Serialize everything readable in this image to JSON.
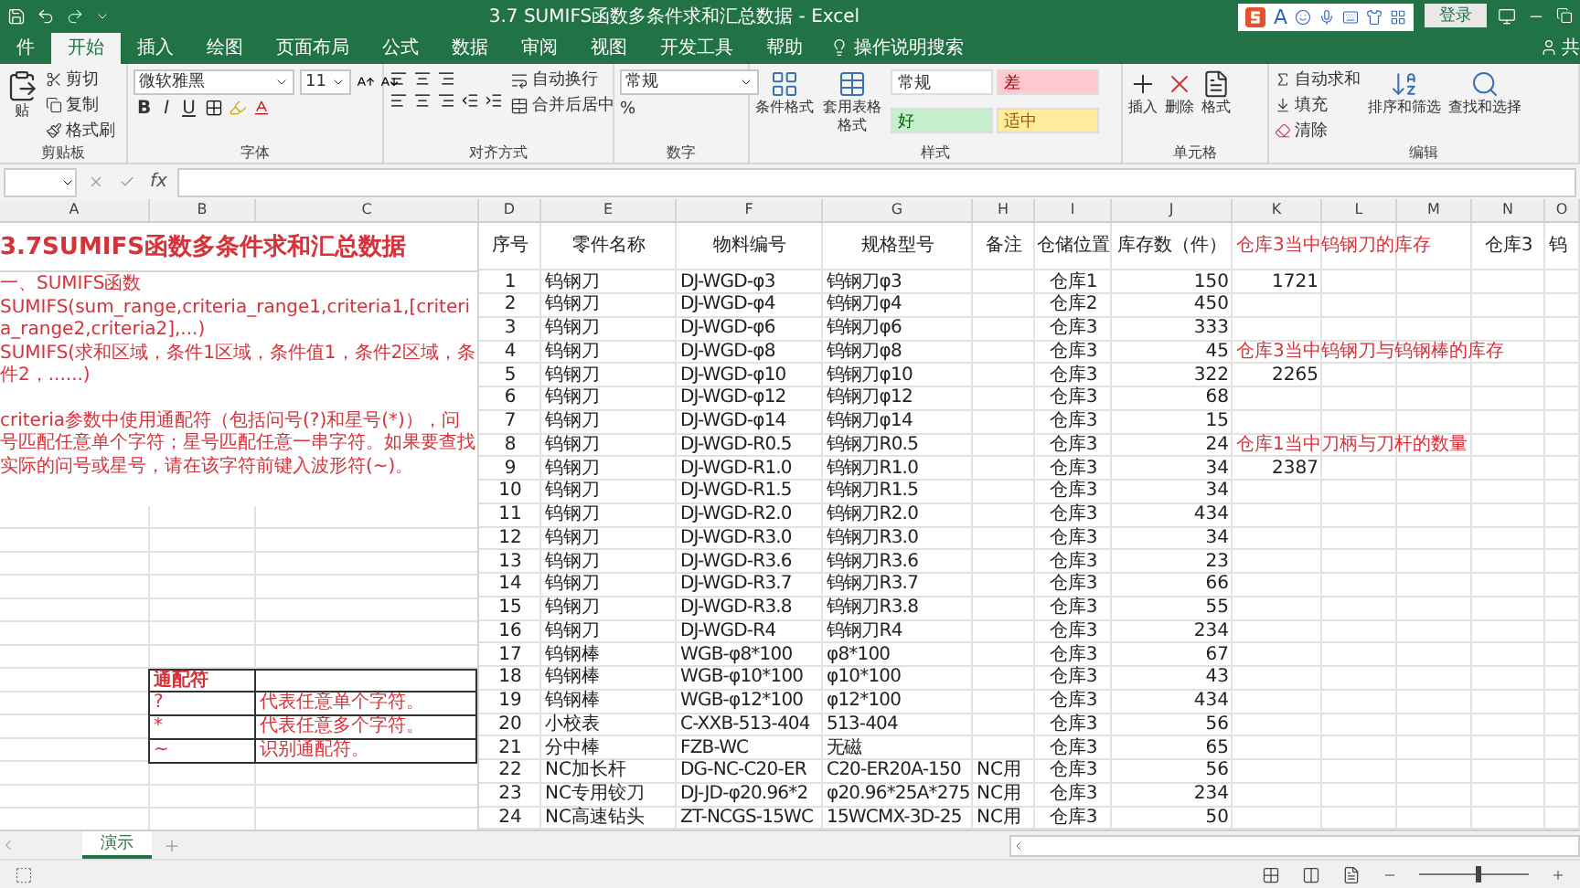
{
  "window": {
    "title": "3.7 SUMIFS函数多条件求和汇总数据  -  Excel",
    "login": "登录",
    "ime": {
      "letter": "A"
    },
    "share": "共"
  },
  "tabs": [
    {
      "label": "件",
      "selected": false
    },
    {
      "label": "开始",
      "selected": true
    },
    {
      "label": "插入",
      "selected": false
    },
    {
      "label": "绘图",
      "selected": false
    },
    {
      "label": "页面布局",
      "selected": false
    },
    {
      "label": "公式",
      "selected": false
    },
    {
      "label": "数据",
      "selected": false
    },
    {
      "label": "审阅",
      "selected": false
    },
    {
      "label": "视图",
      "selected": false
    },
    {
      "label": "开发工具",
      "selected": false
    },
    {
      "label": "帮助",
      "selected": false
    }
  ],
  "tell_me": {
    "placeholder": "操作说明搜索"
  },
  "ribbon": [
    {
      "kind": "clipboard",
      "label": "剪贴板",
      "paste": "贴",
      "items": [
        "剪切",
        "复制",
        "格式刷"
      ]
    },
    {
      "kind": "font",
      "label": "字体",
      "font": "微软雅黑",
      "size": "11",
      "styles": [
        "B",
        "I",
        "U"
      ]
    },
    {
      "kind": "align",
      "label": "对齐方式",
      "items": [
        "自动换行",
        "合并后居中"
      ]
    },
    {
      "kind": "number",
      "label": "数字",
      "format": "常规",
      "percent": "%"
    },
    {
      "kind": "styles",
      "label": "样式",
      "buttons": [
        "条件格式",
        "套用表格格式"
      ],
      "cell_styles": [
        {
          "text": "常规",
          "color": "#ffffff"
        },
        {
          "text": "差",
          "color": "#ffc7ce"
        },
        {
          "text": "好",
          "color": "#c6efce"
        },
        {
          "text": "适中",
          "color": "#ffeb9c"
        }
      ]
    },
    {
      "kind": "cells",
      "label": "单元格",
      "buttons": [
        "插入",
        "删除",
        "格式"
      ]
    },
    {
      "kind": "editing",
      "label": "编辑",
      "items": [
        "自动求和",
        "填充",
        "清除"
      ],
      "buttons": [
        "排序和筛选",
        "查找和选择"
      ]
    }
  ],
  "formula_bar": {
    "fx": "fx"
  },
  "columns": [
    "A",
    "B",
    "C",
    "D",
    "E",
    "F",
    "G",
    "H",
    "I",
    "J",
    "K",
    "L",
    "M",
    "N",
    "O"
  ],
  "sheet_title": "3.7SUMIFS函数多条件求和汇总数据",
  "notes": [
    {
      "kind": "syntax",
      "text": "一、SUMIFS函数"
    },
    {
      "kind": "syntax",
      "text": "SUMIFS(sum_range,criteria_range1,criteria1,[criteria_range2,criteria2],...)"
    },
    {
      "kind": "syntax",
      "text": "SUMIFS(求和区域，条件1区域，条件值1，条件2区域，条件2，......)"
    },
    {
      "kind": "tip",
      "text": "criteria参数中使用通配符（包括问号(?)和星号(*)），问号匹配任意单个字符；星号匹配任意一串字符。如果要查找实际的问号或星号，请在该字符前键入波形符(~)。"
    }
  ],
  "wildcards": {
    "heading": "通配符",
    "rows": [
      {
        "symbol": "?",
        "meaning": "代表任意单个字符。"
      },
      {
        "symbol": "*",
        "meaning": "代表任意多个字符。"
      },
      {
        "symbol": "~",
        "meaning": "识别通配符。"
      }
    ]
  },
  "table": {
    "headers": [
      "序号",
      "零件名称",
      "物料编号",
      "规格型号",
      "备注",
      "仓储位置",
      "库存数（件）"
    ],
    "k_label": "仓库3当中钨钢刀的库存",
    "n_header": "仓库3",
    "o_header": "钨",
    "rows": [
      {
        "no": "1",
        "part": "钨钢刀",
        "code": "DJ-WGD-φ3",
        "spec": "钨钢刀φ3",
        "loc": "仓库1",
        "qty": "150",
        "k": {
          "kind": "value",
          "text": "1721"
        }
      },
      {
        "no": "2",
        "part": "钨钢刀",
        "code": "DJ-WGD-φ4",
        "spec": "钨钢刀φ4",
        "loc": "仓库2",
        "qty": "450"
      },
      {
        "no": "3",
        "part": "钨钢刀",
        "code": "DJ-WGD-φ6",
        "spec": "钨钢刀φ6",
        "loc": "仓库3",
        "qty": "333"
      },
      {
        "no": "4",
        "part": "钨钢刀",
        "code": "DJ-WGD-φ8",
        "spec": "钨钢刀φ8",
        "loc": "仓库3",
        "qty": "45",
        "k": {
          "kind": "label",
          "text": "仓库3当中钨钢刀与钨钢棒的库存"
        }
      },
      {
        "no": "5",
        "part": "钨钢刀",
        "code": "DJ-WGD-φ10",
        "spec": "钨钢刀φ10",
        "loc": "仓库3",
        "qty": "322",
        "k": {
          "kind": "value",
          "text": "2265"
        }
      },
      {
        "no": "6",
        "part": "钨钢刀",
        "code": "DJ-WGD-φ12",
        "spec": "钨钢刀φ12",
        "loc": "仓库3",
        "qty": "68"
      },
      {
        "no": "7",
        "part": "钨钢刀",
        "code": "DJ-WGD-φ14",
        "spec": "钨钢刀φ14",
        "loc": "仓库3",
        "qty": "15"
      },
      {
        "no": "8",
        "part": "钨钢刀",
        "code": "DJ-WGD-R0.5",
        "spec": "钨钢刀R0.5",
        "loc": "仓库3",
        "qty": "24",
        "k": {
          "kind": "label",
          "text": "仓库1当中刀柄与刀杆的数量"
        }
      },
      {
        "no": "9",
        "part": "钨钢刀",
        "code": "DJ-WGD-R1.0",
        "spec": "钨钢刀R1.0",
        "loc": "仓库3",
        "qty": "34",
        "k": {
          "kind": "value",
          "text": "2387"
        }
      },
      {
        "no": "10",
        "part": "钨钢刀",
        "code": "DJ-WGD-R1.5",
        "spec": "钨钢刀R1.5",
        "loc": "仓库3",
        "qty": "34"
      },
      {
        "no": "11",
        "part": "钨钢刀",
        "code": "DJ-WGD-R2.0",
        "spec": "钨钢刀R2.0",
        "loc": "仓库3",
        "qty": "434"
      },
      {
        "no": "12",
        "part": "钨钢刀",
        "code": "DJ-WGD-R3.0",
        "spec": "钨钢刀R3.0",
        "loc": "仓库3",
        "qty": "34"
      },
      {
        "no": "13",
        "part": "钨钢刀",
        "code": "DJ-WGD-R3.6",
        "spec": "钨钢刀R3.6",
        "loc": "仓库3",
        "qty": "23"
      },
      {
        "no": "14",
        "part": "钨钢刀",
        "code": "DJ-WGD-R3.7",
        "spec": "钨钢刀R3.7",
        "loc": "仓库3",
        "qty": "66"
      },
      {
        "no": "15",
        "part": "钨钢刀",
        "code": "DJ-WGD-R3.8",
        "spec": "钨钢刀R3.8",
        "loc": "仓库3",
        "qty": "55"
      },
      {
        "no": "16",
        "part": "钨钢刀",
        "code": "DJ-WGD-R4",
        "spec": "钨钢刀R4",
        "loc": "仓库3",
        "qty": "234"
      },
      {
        "no": "17",
        "part": "钨钢棒",
        "code": "WGB-φ8*100",
        "spec": "φ8*100",
        "loc": "仓库3",
        "qty": "67"
      },
      {
        "no": "18",
        "part": "钨钢棒",
        "code": "WGB-φ10*100",
        "spec": "φ10*100",
        "loc": "仓库3",
        "qty": "43"
      },
      {
        "no": "19",
        "part": "钨钢棒",
        "code": "WGB-φ12*100",
        "spec": "φ12*100",
        "loc": "仓库3",
        "qty": "434"
      },
      {
        "no": "20",
        "part": "小校表",
        "code": "C-XXB-513-404",
        "spec": "513-404",
        "loc": "仓库3",
        "qty": "56"
      },
      {
        "no": "21",
        "part": "分中棒",
        "code": "FZB-WC",
        "spec": "无磁",
        "loc": "仓库3",
        "qty": "65"
      },
      {
        "no": "22",
        "part": "NC加长杆",
        "code": "DG-NC-C20-ER",
        "spec": "C20-ER20A-150",
        "note": "NC用",
        "loc": "仓库3",
        "qty": "56"
      },
      {
        "no": "23",
        "part": "NC专用铰刀",
        "code": "DJ-JD-φ20.96*2",
        "spec": "φ20.96*25A*275",
        "note": "NC用",
        "loc": "仓库3",
        "qty": "234"
      },
      {
        "no": "24",
        "part": "NC高速钻头",
        "code": "ZT-NCGS-15WC",
        "spec": "15WCMX-3D-25",
        "note": "NC用",
        "loc": "仓库3",
        "qty": "50"
      }
    ]
  },
  "sheets": [
    {
      "label": "演示",
      "selected": true
    }
  ],
  "zoom": {
    "level": 0.52
  }
}
